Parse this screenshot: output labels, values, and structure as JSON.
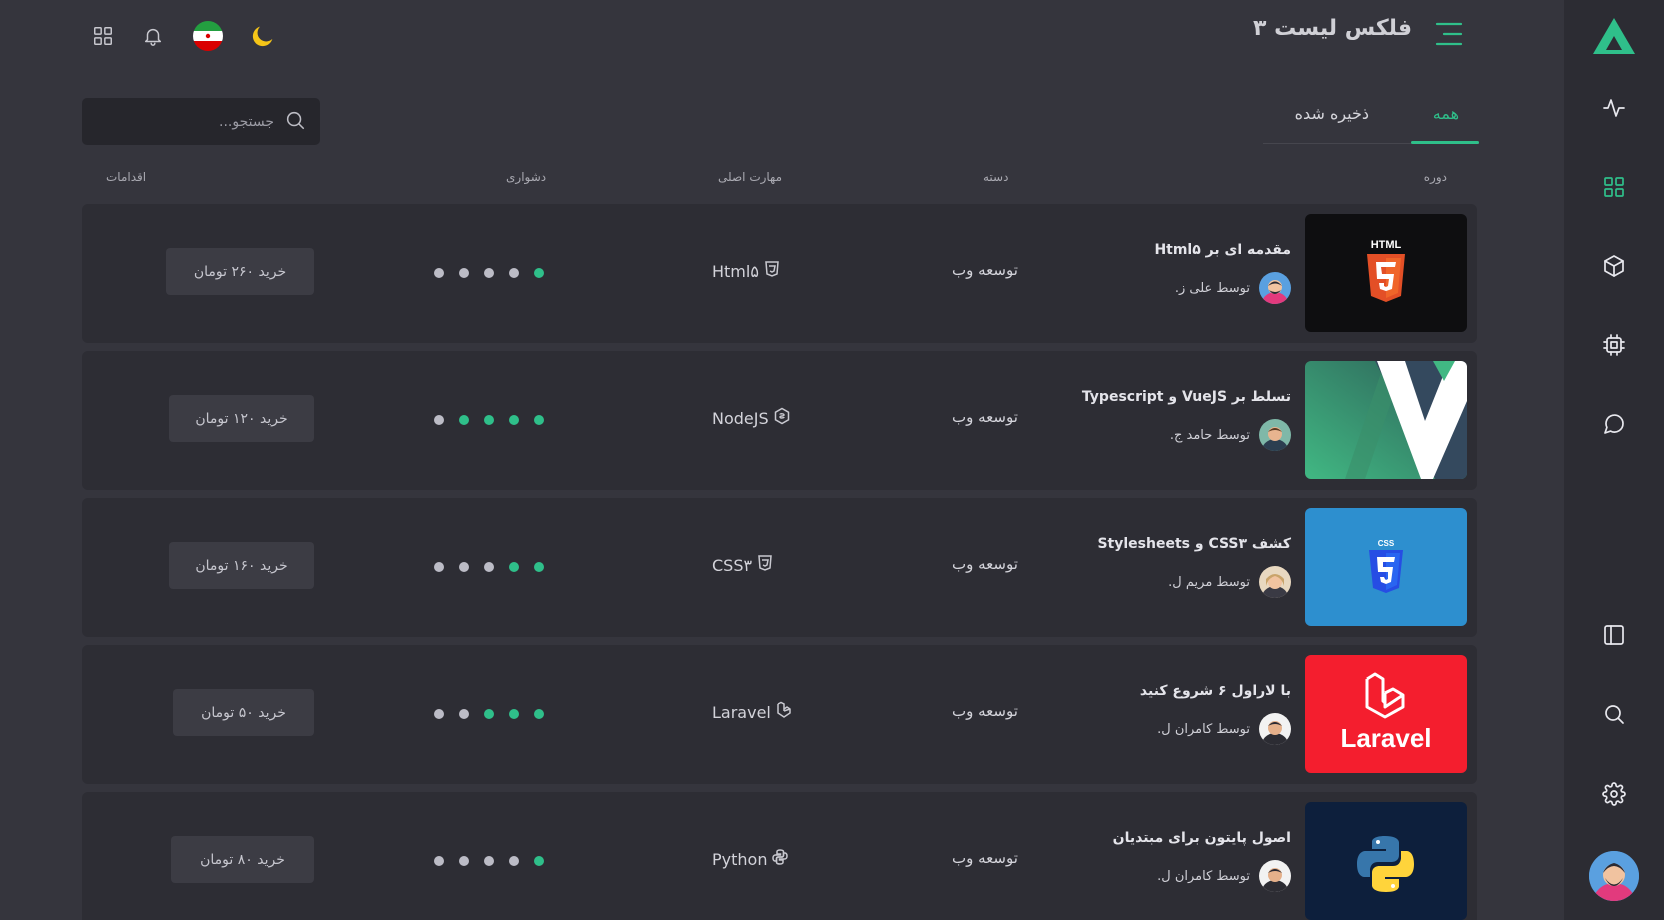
{
  "header": {
    "title": "فلکس لیست ۳",
    "icons": [
      "menu-icon",
      "moon-icon",
      "iran-flag-icon",
      "bell-icon",
      "apps-grid-icon"
    ]
  },
  "tabs": [
    {
      "label": "همه",
      "active": true
    },
    {
      "label": "ذخیره شده",
      "active": false
    }
  ],
  "search": {
    "placeholder": "جستجو..."
  },
  "columns": {
    "course": "دوره",
    "category": "دسته",
    "skill": "مهارت اصلی",
    "difficulty": "دشواری",
    "actions": "اقدامات"
  },
  "courses": [
    {
      "title": "مقدمه ای بر Html۵",
      "author": "توسط علی ز.",
      "category": "توسعه وب",
      "skill": "Html۵",
      "skill_icon": "html-icon",
      "difficulty": 1,
      "buy": "خرید ۲۶۰ تومان",
      "thumb": "html5-logo"
    },
    {
      "title": "تسلط بر VueJS و Typescript",
      "author": "توسط حامد ج.",
      "category": "توسعه وب",
      "skill": "NodeJS",
      "skill_icon": "nodejs-icon",
      "difficulty": 4,
      "buy": "خرید ۱۲۰ تومان",
      "thumb": "vue-logo"
    },
    {
      "title": "کشف CSS۳ و Stylesheets",
      "author": "توسط مریم ل.",
      "category": "توسعه وب",
      "skill": "CSS۳",
      "skill_icon": "css-icon",
      "difficulty": 2,
      "buy": "خرید ۱۶۰ تومان",
      "thumb": "css3-logo"
    },
    {
      "title": "با لاراول ۶ شروع کنید",
      "author": "توسط کامران ل.",
      "category": "توسعه وب",
      "skill": "Laravel",
      "skill_icon": "laravel-icon",
      "difficulty": 3,
      "buy": "خرید ۵۰ تومان",
      "thumb": "laravel-logo",
      "thumb_text": "Laravel"
    },
    {
      "title": "اصول پایتون برای مبتدیان",
      "author": "توسط کامران ل.",
      "category": "توسعه وب",
      "skill": "Python",
      "skill_icon": "python-icon",
      "difficulty": 1,
      "buy": "خرید ۸۰ تومان",
      "thumb": "python-logo"
    }
  ],
  "colors": {
    "accent": "#2fbf8a",
    "background": "#35353d",
    "sidebar": "#2c2c33",
    "row": "#2d2d34"
  },
  "sidebar": {
    "icons": [
      "logo-icon",
      "activity-icon",
      "grid-icon",
      "cube-icon",
      "chip-icon",
      "chat-icon",
      "layout-icon",
      "search-icon",
      "settings-icon"
    ],
    "active": "grid-icon"
  }
}
